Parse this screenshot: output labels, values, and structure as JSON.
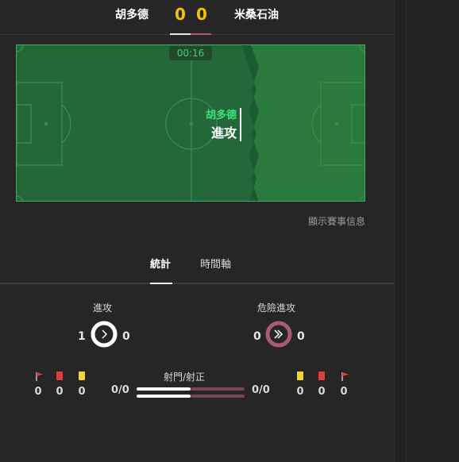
{
  "header": {
    "home_team": "胡多德",
    "away_team": "米桑石油",
    "home_score": "0",
    "away_score": "0"
  },
  "pitch": {
    "time": "00:16",
    "attack_team": "胡多德",
    "attack_label": "進攻"
  },
  "event_link": "顯示賽事信息",
  "tabs": [
    {
      "label": "統計",
      "active": true
    },
    {
      "label": "時間軸",
      "active": false
    }
  ],
  "stats": {
    "attack": {
      "title": "進攻",
      "home": "1",
      "away": "0",
      "home_fraction": 1.0
    },
    "danger": {
      "title": "危險進攻",
      "home": "0",
      "away": "0",
      "home_fraction": 0.0
    }
  },
  "cards": {
    "home": {
      "corners": "0",
      "red": "0",
      "yellow": "0"
    },
    "away": {
      "yellow": "0",
      "red": "0",
      "corners": "0"
    }
  },
  "shots": {
    "title": "射門/射正",
    "home": "0/0",
    "away": "0/0"
  },
  "colors": {
    "home": "#ffffff",
    "away": "#a85a78",
    "accent_green": "#3ce07d",
    "score_yellow": "#f5c400"
  }
}
